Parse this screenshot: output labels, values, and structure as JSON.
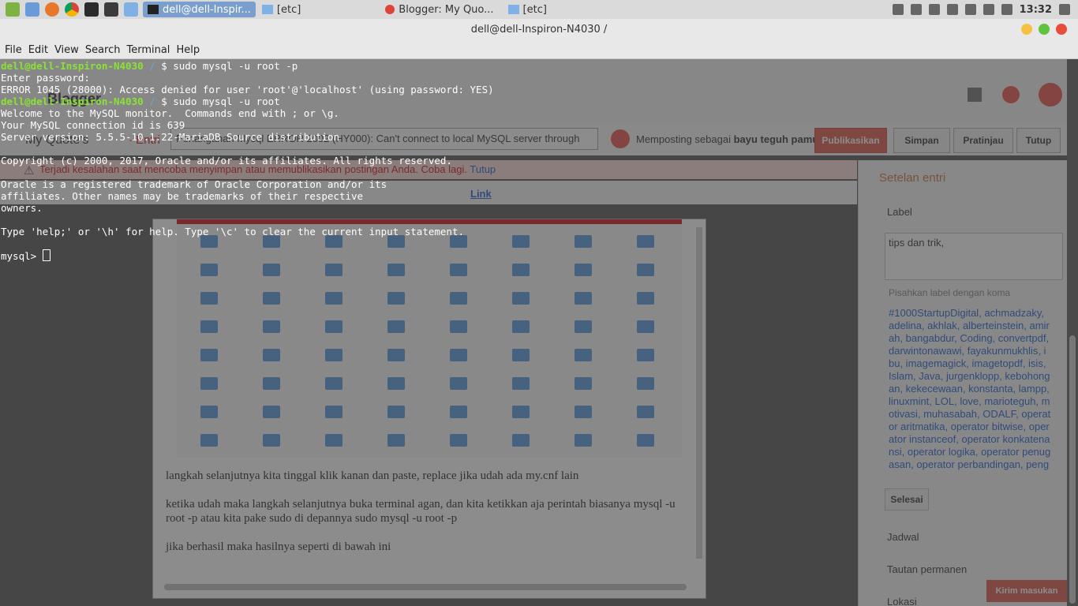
{
  "taskbar": {
    "tasks": [
      {
        "label": "dell@dell-Inspir...",
        "active": true
      },
      {
        "label": "[etc]",
        "active": false
      },
      {
        "label": "Blogger: My Quo...",
        "active": false
      },
      {
        "label": "[etc]",
        "active": false
      }
    ],
    "clock": "13:32",
    "launcher_icons": [
      "menu-icon",
      "files-icon",
      "firefox-icon",
      "chrome-icon",
      "terminal-icon",
      "editor-icon",
      "folder-icon"
    ]
  },
  "window": {
    "title": "dell@dell-Inspiron-N4030 /",
    "menus": [
      "File",
      "Edit",
      "View",
      "Search",
      "Terminal",
      "Help"
    ]
  },
  "terminal": {
    "user_host": "dell@dell-Inspiron-N4030",
    "path": " / ",
    "lines": [
      {
        "type": "prompt",
        "cmd": "$ sudo mysql -u root -p"
      },
      {
        "type": "out",
        "text": "Enter password:"
      },
      {
        "type": "out",
        "text": "ERROR 1045 (28000): Access denied for user 'root'@'localhost' (using password: YES)"
      },
      {
        "type": "prompt",
        "cmd": "$ sudo mysql -u root"
      },
      {
        "type": "out",
        "text": "Welcome to the MySQL monitor.  Commands end with ; or \\g."
      },
      {
        "type": "out",
        "text": "Your MySQL connection id is 639"
      },
      {
        "type": "out",
        "text": "Server version: 5.5.5-10.1.22-MariaDB Source distribution"
      },
      {
        "type": "out",
        "text": ""
      },
      {
        "type": "out",
        "text": "Copyright (c) 2000, 2017, Oracle and/or its affiliates. All rights reserved."
      },
      {
        "type": "out",
        "text": ""
      },
      {
        "type": "out",
        "text": "Oracle is a registered trademark of Oracle Corporation and/or its"
      },
      {
        "type": "out",
        "text": "affiliates. Other names may be trademarks of their respective"
      },
      {
        "type": "out",
        "text": "owners."
      },
      {
        "type": "out",
        "text": ""
      },
      {
        "type": "out",
        "text": "Type 'help;' or '\\h' for help. Type '\\c' to clear the current input statement."
      },
      {
        "type": "out",
        "text": ""
      },
      {
        "type": "input",
        "text": "mysql> "
      }
    ]
  },
  "blogger": {
    "logo": "Blogger",
    "blog_name": "My Quote's",
    "entri": "· Entri",
    "post_title": "Penanganan Mysql ERROR 2002 (HY000): Can't connect to local MySQL server through",
    "posting_as_prefix": "Memposting sebagai ",
    "posting_as_name": "bayu teguh pamuji",
    "buttons": {
      "publish": "Publikasikan",
      "save": "Simpan",
      "preview": "Pratinjau",
      "close": "Tutup"
    },
    "error": {
      "message": "Terjadi kesalahan saat mencoba menyimpan atau memublikasikan postingan Anda. Coba lagi.",
      "retry": "Tutup"
    },
    "toolbar_link": "Link",
    "paragraphs": [
      "langkah selanjutnya kita tinggal klik kanan dan paste, replace jika udah ada my.cnf lain",
      "ketika udah maka langkah selanjutnya buka terminal agan, dan kita ketikkan aja perintah biasanya mysql -u root -p atau kita pake sudo di depannya sudo mysql -u root -p",
      "jika berhasil maka hasilnya seperti di bawah ini"
    ],
    "sidebar": {
      "settings_title": "Setelan entri",
      "label_title": "Label",
      "label_value": "tips dan trik,",
      "label_hint": "Pisahkan label dengan koma",
      "label_list": "#1000StartupDigital, achmadzaky, adelina, akhlak, alberteinstein, amirah, bangabdur, Coding, convertpdf, darwintonawawi, fayakunmukhlis, ibu, imagemagick, imagetopdf, isis, Islam, Java, jurgenklopp, kebohongan, kekecewaan, konstanta, lampp, linuxmint, LOL, love, marioteguh, motivasi, muhasabah, ODALF, operator aritmatika, operator bitwise, operator instanceof, operator konkatenansi, operator logika, operator penugasan, operator perbandingan, pengusaha, PHP, ProgrammerWeb, q",
      "done_button": "Selesai",
      "schedule": "Jadwal",
      "permalink": "Tautan permanen",
      "location": "Lokasi",
      "feedback_button": "Kirim masukan"
    }
  },
  "colors": {
    "terminal_bg": "#464646",
    "prompt_user": "#8ae234",
    "prompt_path": "#729fcf",
    "accent_red": "#dd4b39"
  }
}
